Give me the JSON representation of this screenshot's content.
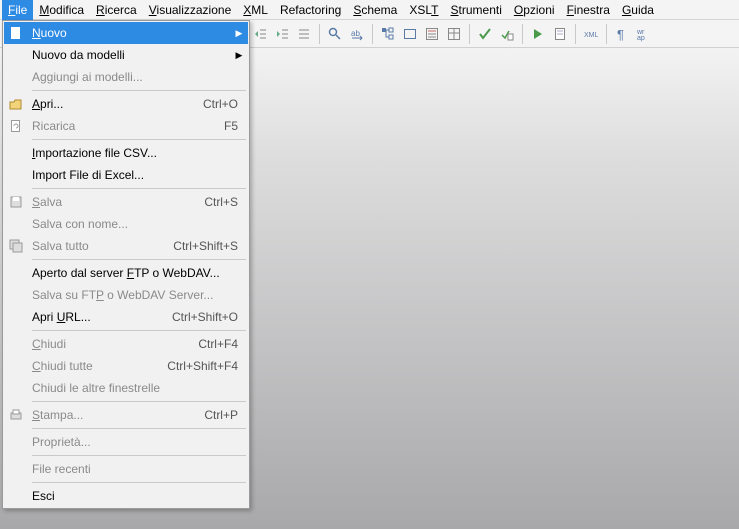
{
  "menubar": {
    "items": [
      {
        "label": "File",
        "mn": "F",
        "rest": "ile",
        "active": true
      },
      {
        "label": "Modifica",
        "mn": "M",
        "rest": "odifica"
      },
      {
        "label": "Ricerca",
        "mn": "R",
        "rest": "icerca"
      },
      {
        "label": "Visualizzazione",
        "mn": "V",
        "rest": "isualizzazione"
      },
      {
        "label": "XML",
        "mn": "X",
        "rest": "ML"
      },
      {
        "label": "Refactoring",
        "mn": "",
        "rest": "Refactoring"
      },
      {
        "label": "Schema",
        "mn": "S",
        "rest": "chema"
      },
      {
        "label": "XSLT",
        "mn": "",
        "rest": "XSL",
        "post_mn": "T"
      },
      {
        "label": "Strumenti",
        "mn": "S",
        "rest": "trumenti"
      },
      {
        "label": "Opzioni",
        "mn": "O",
        "rest": "pzioni"
      },
      {
        "label": "Finestra",
        "mn": "F",
        "rest": "inestra"
      },
      {
        "label": "Guida",
        "mn": "G",
        "rest": "uida"
      }
    ]
  },
  "dropdown": {
    "items": [
      {
        "label": "Nuovo",
        "mn": "N",
        "rest": "uovo",
        "icon": "page-icon",
        "highlight": true,
        "submenu": true
      },
      {
        "label": "Nuovo da modelli",
        "mn": "",
        "rest": "Nuovo da modelli",
        "submenu": true
      },
      {
        "label": "Aggiungi ai modelli...",
        "mn": "",
        "rest": "Aggiungi ai modelli...",
        "disabled": true
      },
      {
        "sep": true
      },
      {
        "label": "Apri...",
        "mn": "A",
        "rest": "pri...",
        "icon": "open-icon",
        "shortcut": "Ctrl+O"
      },
      {
        "label": "Ricarica",
        "mn": "",
        "rest": "Ricarica",
        "icon": "reload-icon",
        "shortcut": "F5",
        "disabled": true
      },
      {
        "sep": true
      },
      {
        "label": "Importazione file CSV...",
        "mn": "I",
        "rest": "mportazione file CSV..."
      },
      {
        "label": "Import File di Excel...",
        "mn": "",
        "rest": "Import File di Excel..."
      },
      {
        "sep": true
      },
      {
        "label": "Salva",
        "mn": "S",
        "rest": "alva",
        "icon": "save-icon",
        "shortcut": "Ctrl+S",
        "disabled": true
      },
      {
        "label": "Salva con nome...",
        "mn": "",
        "rest": "Salva con nome...",
        "disabled": true
      },
      {
        "label": "Salva tutto",
        "mn": "",
        "rest": "Salva tutto",
        "icon": "save-all-icon",
        "shortcut": "Ctrl+Shift+S",
        "disabled": true
      },
      {
        "sep": true
      },
      {
        "label": "Aperto dal server FTP o WebDAV...",
        "mn": "",
        "rest": "Aperto dal server ",
        "mid_mn": "F",
        "post": "TP o WebDAV..."
      },
      {
        "label": "Salva su FTP o WebDAV Server...",
        "mn": "",
        "rest": "Salva su FT",
        "mid_mn": "P",
        "post": " o WebDAV Server...",
        "disabled": true
      },
      {
        "label": "Apri URL...",
        "mn": "",
        "rest": "Apri ",
        "mid_mn": "U",
        "post": "RL...",
        "shortcut": "Ctrl+Shift+O"
      },
      {
        "sep": true
      },
      {
        "label": "Chiudi",
        "mn": "C",
        "rest": "hiudi",
        "shortcut": "Ctrl+F4",
        "disabled": true
      },
      {
        "label": "Chiudi tutte",
        "mn": "C",
        "rest": "hiudi tutte",
        "shortcut": "Ctrl+Shift+F4",
        "disabled": true
      },
      {
        "label": "Chiudi le altre finestrelle",
        "mn": "",
        "rest": "Chiudi le altre finestrelle",
        "disabled": true
      },
      {
        "sep": true
      },
      {
        "label": "Stampa...",
        "mn": "S",
        "rest": "tampa...",
        "icon": "print-icon",
        "shortcut": "Ctrl+P",
        "disabled": true
      },
      {
        "sep": true
      },
      {
        "label": "Proprietà...",
        "mn": "",
        "rest": "Proprietà...",
        "disabled": true
      },
      {
        "sep": true
      },
      {
        "label": "File recenti",
        "mn": "",
        "rest": "File recenti",
        "disabled": true
      },
      {
        "sep": true
      },
      {
        "label": "Esci",
        "mn": "",
        "rest": "Esci"
      }
    ]
  },
  "toolbar": {
    "groups": [
      [
        "outdent-icon",
        "indent-icon",
        "list-icon"
      ],
      [
        "find-icon",
        "replace-icon"
      ],
      [
        "tree-icon",
        "rect-icon",
        "form-icon",
        "grid-icon"
      ],
      [
        "check-icon",
        "validate-icon"
      ],
      [
        "play-icon",
        "sheet-icon"
      ],
      [
        "xml-icon"
      ],
      [
        "pilcrow-icon",
        "wrap-icon"
      ]
    ]
  }
}
